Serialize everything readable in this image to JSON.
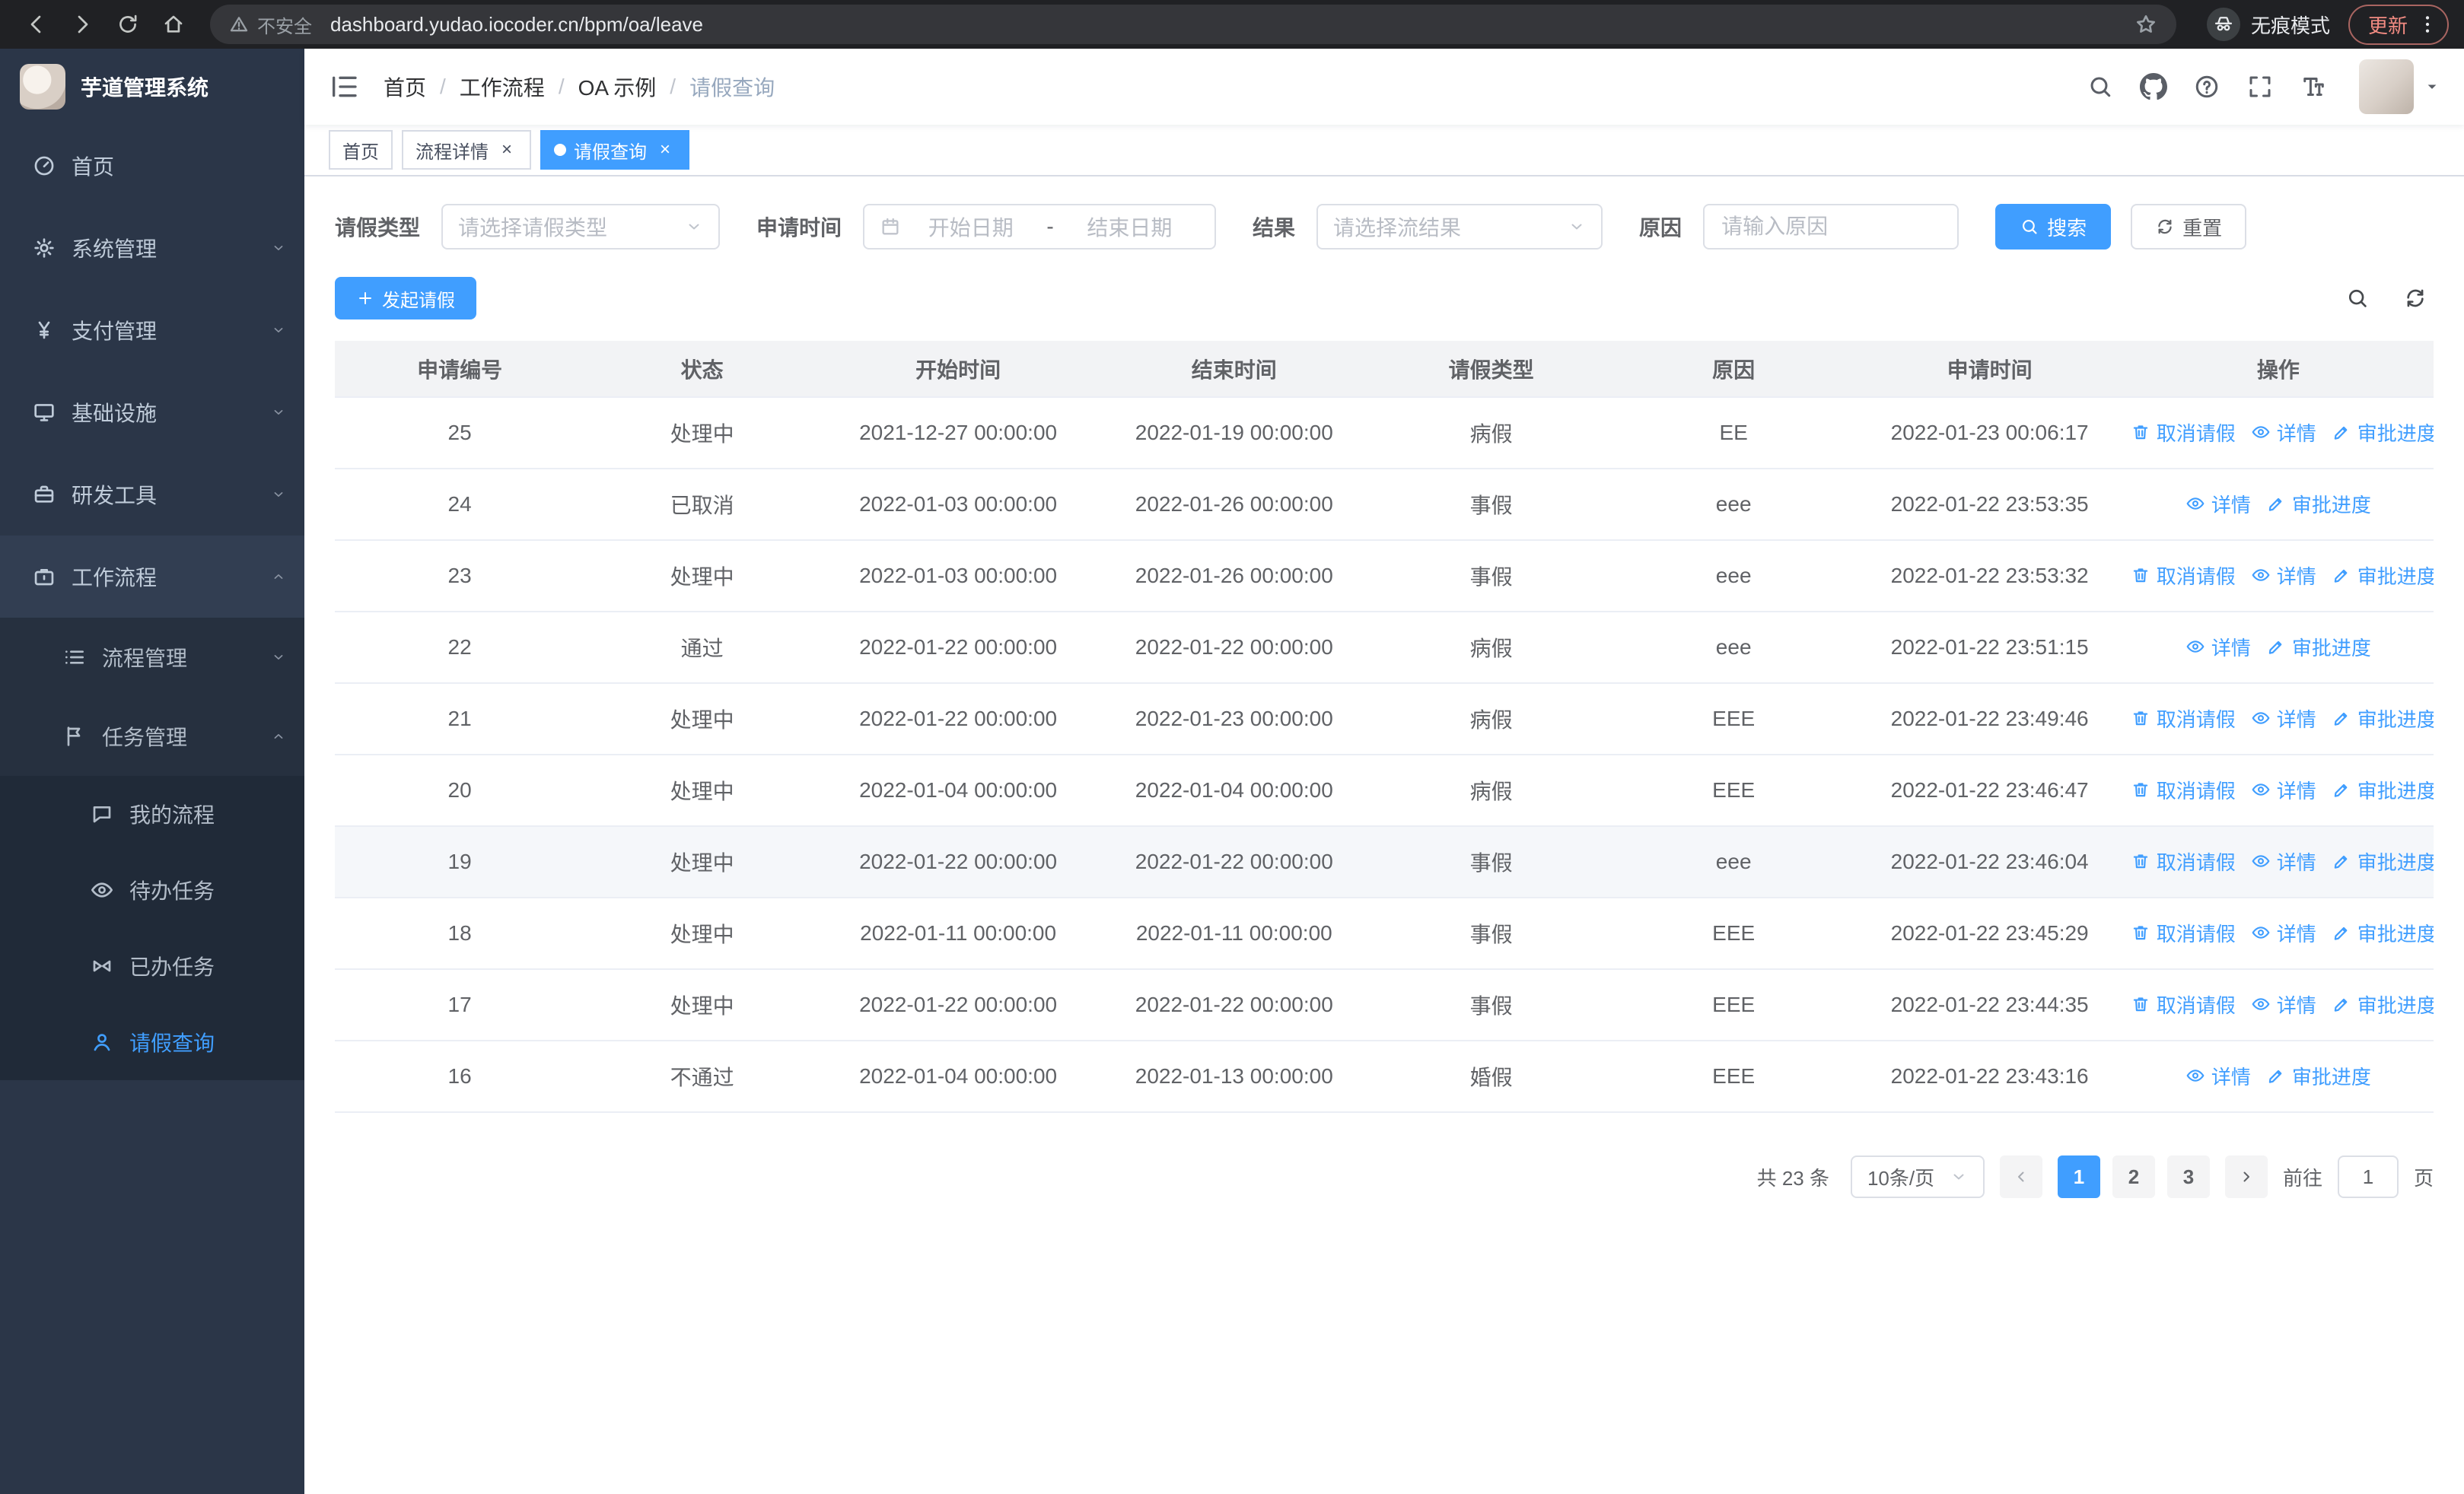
{
  "browser": {
    "security_warning": "不安全",
    "url": "dashboard.yudao.iocoder.cn/bpm/oa/leave",
    "incognito_label": "无痕模式",
    "update_label": "更新"
  },
  "sidebar": {
    "logo_title": "芋道管理系统",
    "items": [
      {
        "key": "home",
        "label": "首页",
        "icon": "gauge-icon",
        "depth": 0
      },
      {
        "key": "system-management",
        "label": "系统管理",
        "icon": "gear-icon",
        "depth": 0,
        "arrow": "down"
      },
      {
        "key": "payment-management",
        "label": "支付管理",
        "icon": "yen-icon",
        "depth": 0,
        "arrow": "down"
      },
      {
        "key": "infrastructure",
        "label": "基础设施",
        "icon": "monitor-icon",
        "depth": 0,
        "arrow": "down"
      },
      {
        "key": "dev-tools",
        "label": "研发工具",
        "icon": "toolbox-icon",
        "depth": 0,
        "arrow": "down"
      },
      {
        "key": "workflow",
        "label": "工作流程",
        "icon": "briefcase-icon",
        "depth": 0,
        "arrow": "up",
        "expanded": true
      },
      {
        "key": "process-management",
        "label": "流程管理",
        "icon": "list-icon",
        "depth": 1,
        "arrow": "down"
      },
      {
        "key": "task-management",
        "label": "任务管理",
        "icon": "flag-icon",
        "depth": 1,
        "arrow": "up",
        "expanded": true
      },
      {
        "key": "my-process",
        "label": "我的流程",
        "icon": "chat-icon",
        "depth": 2
      },
      {
        "key": "todo-tasks",
        "label": "待办任务",
        "icon": "eye-icon",
        "depth": 2
      },
      {
        "key": "done-tasks",
        "label": "已办任务",
        "icon": "bowtie-icon",
        "depth": 2
      },
      {
        "key": "leave-query",
        "label": "请假查询",
        "icon": "user-icon",
        "depth": 2,
        "active": true
      }
    ]
  },
  "header": {
    "breadcrumb": [
      "首页",
      "工作流程",
      "OA 示例",
      "请假查询"
    ]
  },
  "tabs": [
    {
      "key": "home",
      "label": "首页",
      "closable": false,
      "active": false
    },
    {
      "key": "process-detail",
      "label": "流程详情",
      "closable": true,
      "active": false
    },
    {
      "key": "leave-query",
      "label": "请假查询",
      "closable": true,
      "active": true
    }
  ],
  "filters": {
    "leave_type_label": "请假类型",
    "leave_type_placeholder": "请选择请假类型",
    "apply_time_label": "申请时间",
    "start_date_placeholder": "开始日期",
    "range_separator": "-",
    "end_date_placeholder": "结束日期",
    "result_label": "结果",
    "result_placeholder": "请选择流结果",
    "reason_label": "原因",
    "reason_placeholder": "请输入原因",
    "search_label": "搜索",
    "reset_label": "重置"
  },
  "toolbar": {
    "create_label": "发起请假"
  },
  "table": {
    "columns": [
      "申请编号",
      "状态",
      "开始时间",
      "结束时间",
      "请假类型",
      "原因",
      "申请时间",
      "操作"
    ],
    "action_labels": {
      "cancel": "取消请假",
      "detail": "详情",
      "progress": "审批进度"
    },
    "rows": [
      {
        "id": "25",
        "status": "处理中",
        "start": "2021-12-27 00:00:00",
        "end": "2022-01-19 00:00:00",
        "type": "病假",
        "reason": "EE",
        "apply_time": "2022-01-23 00:06:17",
        "actions": [
          "cancel",
          "detail",
          "progress"
        ]
      },
      {
        "id": "24",
        "status": "已取消",
        "start": "2022-01-03 00:00:00",
        "end": "2022-01-26 00:00:00",
        "type": "事假",
        "reason": "eee",
        "apply_time": "2022-01-22 23:53:35",
        "actions": [
          "detail",
          "progress"
        ]
      },
      {
        "id": "23",
        "status": "处理中",
        "start": "2022-01-03 00:00:00",
        "end": "2022-01-26 00:00:00",
        "type": "事假",
        "reason": "eee",
        "apply_time": "2022-01-22 23:53:32",
        "actions": [
          "cancel",
          "detail",
          "progress"
        ]
      },
      {
        "id": "22",
        "status": "通过",
        "start": "2022-01-22 00:00:00",
        "end": "2022-01-22 00:00:00",
        "type": "病假",
        "reason": "eee",
        "apply_time": "2022-01-22 23:51:15",
        "actions": [
          "detail",
          "progress"
        ]
      },
      {
        "id": "21",
        "status": "处理中",
        "start": "2022-01-22 00:00:00",
        "end": "2022-01-23 00:00:00",
        "type": "病假",
        "reason": "EEE",
        "apply_time": "2022-01-22 23:49:46",
        "actions": [
          "cancel",
          "detail",
          "progress"
        ]
      },
      {
        "id": "20",
        "status": "处理中",
        "start": "2022-01-04 00:00:00",
        "end": "2022-01-04 00:00:00",
        "type": "病假",
        "reason": "EEE",
        "apply_time": "2022-01-22 23:46:47",
        "actions": [
          "cancel",
          "detail",
          "progress"
        ]
      },
      {
        "id": "19",
        "status": "处理中",
        "start": "2022-01-22 00:00:00",
        "end": "2022-01-22 00:00:00",
        "type": "事假",
        "reason": "eee",
        "apply_time": "2022-01-22 23:46:04",
        "actions": [
          "cancel",
          "detail",
          "progress"
        ],
        "highlight": true
      },
      {
        "id": "18",
        "status": "处理中",
        "start": "2022-01-11 00:00:00",
        "end": "2022-01-11 00:00:00",
        "type": "事假",
        "reason": "EEE",
        "apply_time": "2022-01-22 23:45:29",
        "actions": [
          "cancel",
          "detail",
          "progress"
        ]
      },
      {
        "id": "17",
        "status": "处理中",
        "start": "2022-01-22 00:00:00",
        "end": "2022-01-22 00:00:00",
        "type": "事假",
        "reason": "EEE",
        "apply_time": "2022-01-22 23:44:35",
        "actions": [
          "cancel",
          "detail",
          "progress"
        ]
      },
      {
        "id": "16",
        "status": "不通过",
        "start": "2022-01-04 00:00:00",
        "end": "2022-01-13 00:00:00",
        "type": "婚假",
        "reason": "EEE",
        "apply_time": "2022-01-22 23:43:16",
        "actions": [
          "detail",
          "progress"
        ]
      }
    ]
  },
  "pagination": {
    "total_text": "共 23 条",
    "page_size": "10条/页",
    "pages": [
      "1",
      "2",
      "3"
    ],
    "active_page": "1",
    "goto_label": "前往",
    "goto_value": "1",
    "goto_suffix": "页"
  },
  "colors": {
    "accent": "#409eff",
    "sidebar_bg": "#2b3648",
    "chrome_bg": "#202124"
  }
}
